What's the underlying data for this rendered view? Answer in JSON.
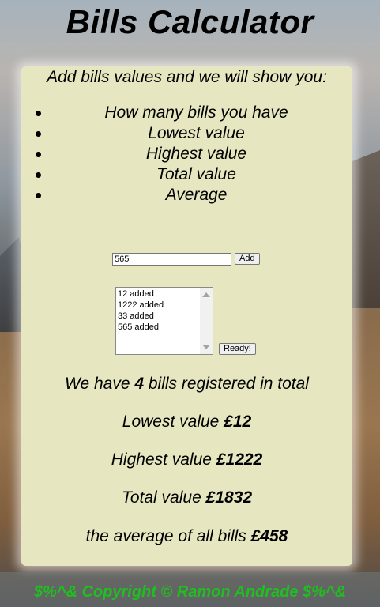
{
  "page": {
    "title": "Bills Calculator"
  },
  "intro": "Add bills values and we will show you:",
  "features": [
    "How many bills you have",
    "Lowest value",
    "Highest value",
    "Total value",
    "Average"
  ],
  "input": {
    "value": "565",
    "add_label": "Add"
  },
  "bill_list": [
    "12 added",
    "1222 added",
    "33 added",
    "565 added"
  ],
  "ready_label": "Ready!",
  "results": {
    "count_prefix": "We have",
    "count": "4",
    "count_suffix": "bills registered in total",
    "lowest_label": "Lowest value",
    "lowest": "£12",
    "highest_label": "Highest value",
    "highest": "£1222",
    "total_label": "Total value",
    "total": "£1832",
    "average_label": "the average of all bills",
    "average": "£458"
  },
  "footer": "$%^& Copyright © Ramon Andrade $%^&"
}
